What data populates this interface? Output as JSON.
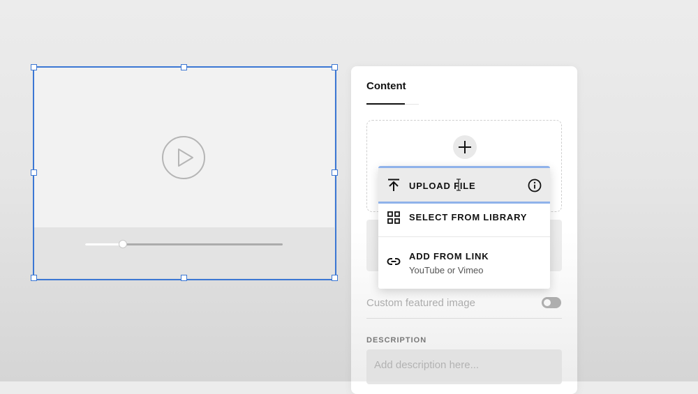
{
  "panel": {
    "tab_label": "Content",
    "custom_featured_image_label": "Custom featured image",
    "description_label": "DESCRIPTION",
    "description_placeholder": "Add description here..."
  },
  "upload_menu": {
    "items": [
      {
        "label": "UPLOAD FILE",
        "icon": "upload-icon",
        "trailing_icon": "info-icon"
      },
      {
        "label": "SELECT FROM LIBRARY",
        "icon": "grid-icon"
      },
      {
        "label": "ADD FROM LINK",
        "sublabel": "YouTube or Vimeo",
        "icon": "link-icon"
      }
    ]
  },
  "video_player": {
    "progress_fraction": 0.19,
    "icon": "play-icon"
  },
  "colors": {
    "selection": "#3b77d4",
    "menu_highlight_border": "#8fb2ea",
    "toggle_off": "#9d9d9d"
  }
}
